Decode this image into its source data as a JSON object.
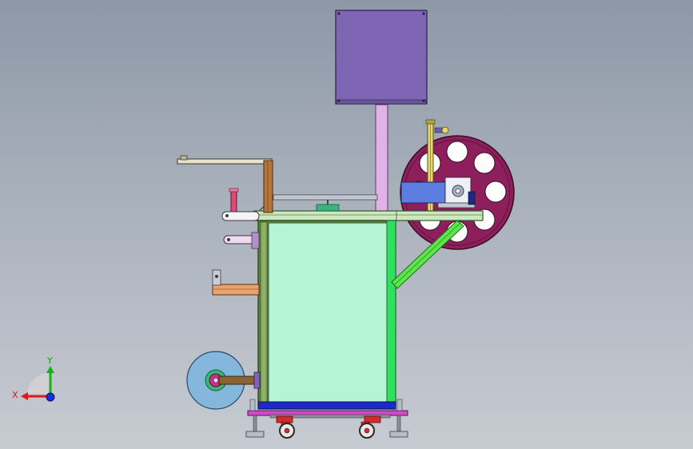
{
  "viewport": {
    "background_top": "#8d97a6",
    "background_bottom": "#c7cbd2"
  },
  "triad": {
    "x_label": "X",
    "y_label": "Y",
    "x_color": "#e01818",
    "y_color": "#18b018",
    "z_color": "#1830e0"
  },
  "colors": {
    "control_box": "#7e66b4",
    "frame": "#5e8a3e",
    "panel": "#b5f5d6",
    "reel": "#8c1f5c",
    "mast": "#e0b2e8",
    "brace": "#5ce64a",
    "motor": "#5c7ee0",
    "film_roll": "#85b7dd"
  }
}
